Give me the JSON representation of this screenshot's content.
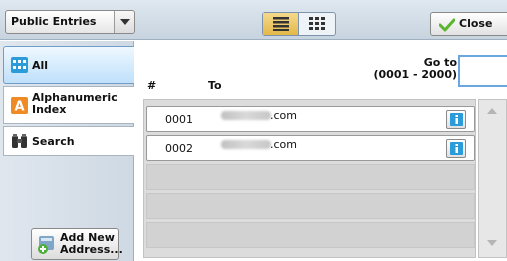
{
  "toolbar": {
    "dropdown_value": "Public Entries",
    "close_label": "Close",
    "view_modes": [
      "list",
      "grid"
    ]
  },
  "sidebar": {
    "tabs": [
      {
        "label": "All",
        "icon": "address-book-icon"
      },
      {
        "label": "Alphanumeric Index",
        "icon": "alphabet-a-icon"
      },
      {
        "label": "Search",
        "icon": "binoculars-icon"
      }
    ],
    "add_button_label_line1": "Add New",
    "add_button_label_line2": "Address..."
  },
  "list": {
    "header_number": "#",
    "header_to": "To",
    "goto_label": "Go to",
    "goto_range": "(0001 - 2000)",
    "rows": [
      {
        "number": "0001",
        "to_suffix": ".com"
      },
      {
        "number": "0002",
        "to_suffix": ".com"
      }
    ]
  },
  "colors": {
    "accent_selected": "#bfe0fb",
    "active_view": "#e4b848"
  }
}
